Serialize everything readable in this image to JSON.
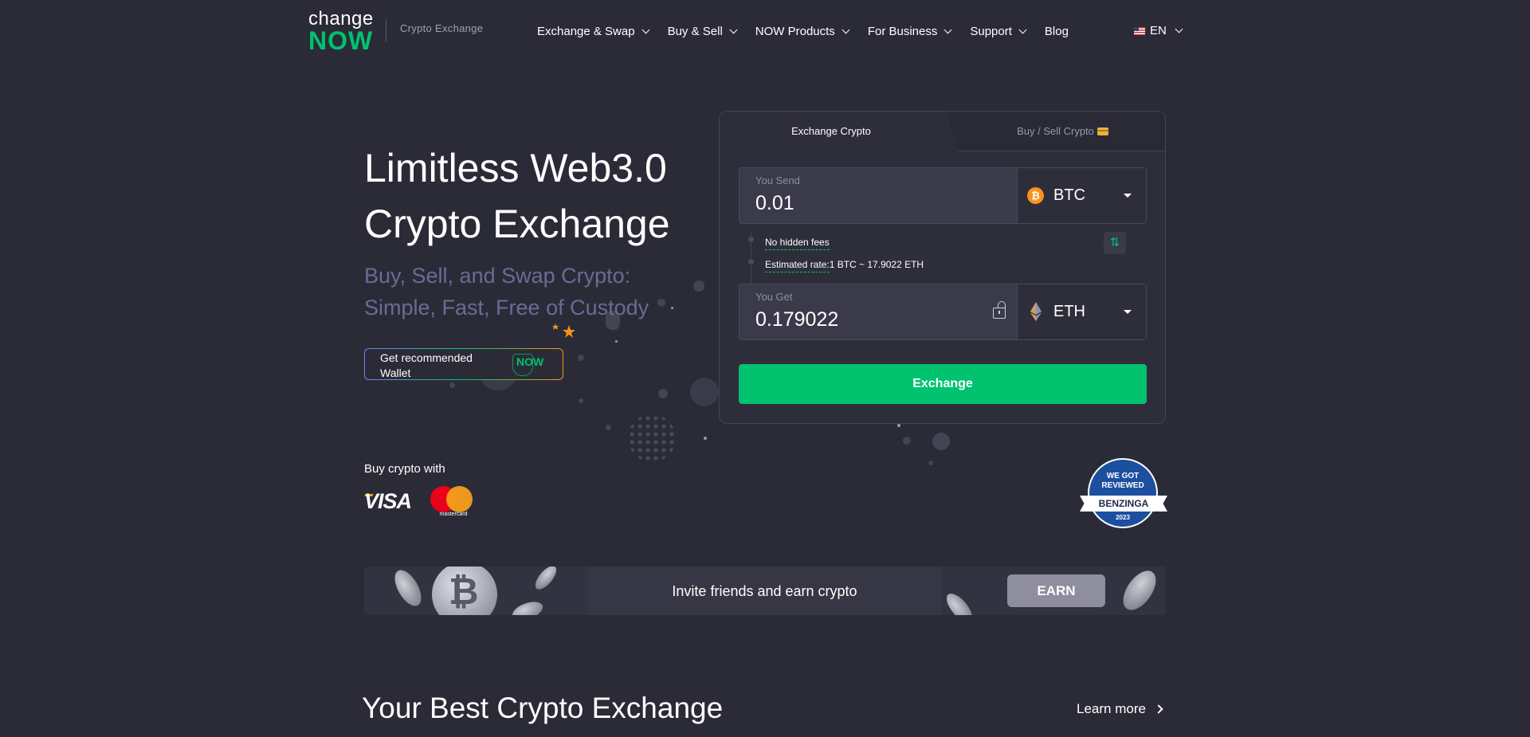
{
  "header": {
    "logo_change": "change",
    "logo_now": "NOW",
    "subtitle": "Crypto Exchange",
    "nav": [
      "Exchange & Swap",
      "Buy & Sell",
      "NOW Products",
      "For Business",
      "Support",
      "Blog"
    ],
    "lang": "EN"
  },
  "hero": {
    "title": "Limitless Web3.0 Crypto Exchange",
    "subtitle": "Buy, Sell, and Swap Crypto: Simple, Fast, Free of Custody",
    "wallet_button": "Get recommended Wallet",
    "wallet_badge": "NOW"
  },
  "widget": {
    "tab_exchange": "Exchange Crypto",
    "tab_buy_sell": "Buy / Sell Crypto",
    "send_label": "You Send",
    "send_value": "0.01",
    "send_currency": "BTC",
    "get_label": "You Get",
    "get_value": "0.179022",
    "get_currency": "ETH",
    "no_fees": "No hidden fees",
    "rate_label": "Estimated rate:",
    "rate_value": "1 BTC ~ 17.9022 ETH",
    "exchange_button": "Exchange"
  },
  "payments": {
    "buy_with": "Buy crypto with",
    "visa": "VISA",
    "mastercard": "mastercard"
  },
  "benzinga": {
    "line1": "WE GOT REVIEWED",
    "name": "BENZINGA",
    "year": "2023"
  },
  "invite": {
    "text": "Invite friends and earn crypto",
    "button": "EARN"
  },
  "section": {
    "title": "Your Best Crypto Exchange",
    "learn_more": "Learn more"
  },
  "colors": {
    "background": "#2b2b37",
    "accent": "#00c26f",
    "btc": "#f7931a"
  }
}
